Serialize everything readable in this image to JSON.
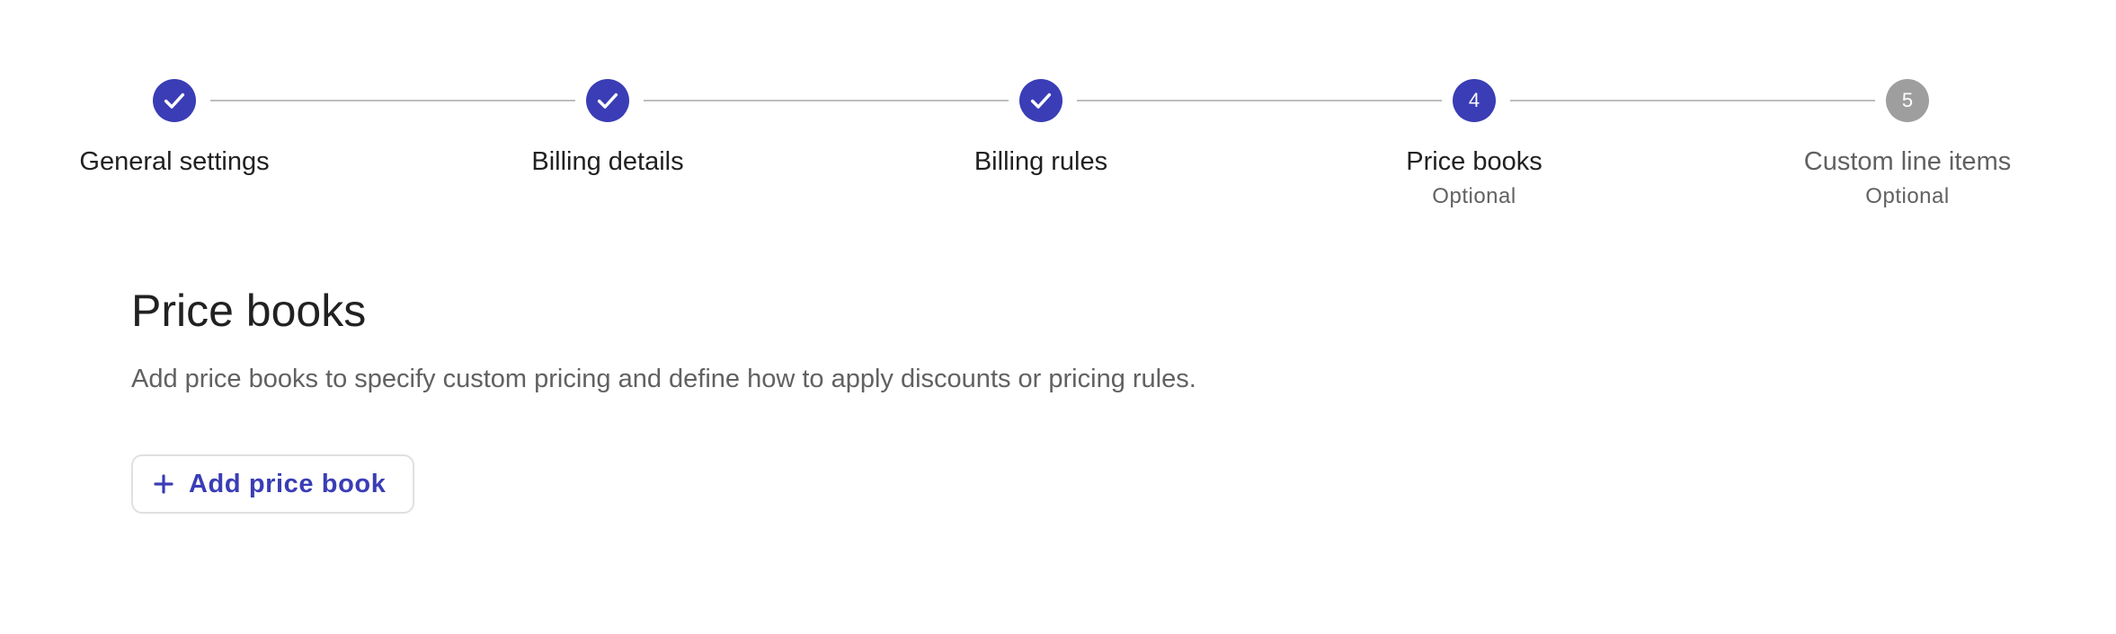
{
  "colors": {
    "accent": "#3a3db5",
    "inactive": "#9e9e9e",
    "connector": "#bdbdbd",
    "title_text": "#212121",
    "secondary_text": "#616161",
    "active_label": "#212121",
    "inactive_label": "#616161"
  },
  "stepper": {
    "steps": [
      {
        "number": "1",
        "label": "General settings",
        "sublabel": "",
        "state": "completed"
      },
      {
        "number": "2",
        "label": "Billing details",
        "sublabel": "",
        "state": "completed"
      },
      {
        "number": "3",
        "label": "Billing rules",
        "sublabel": "",
        "state": "completed"
      },
      {
        "number": "4",
        "label": "Price books",
        "sublabel": "Optional",
        "state": "active"
      },
      {
        "number": "5",
        "label": "Custom line items",
        "sublabel": "Optional",
        "state": "upcoming"
      }
    ]
  },
  "main": {
    "title": "Price books",
    "description": "Add price books to specify custom pricing and define how to apply discounts or pricing rules.",
    "add_button_label": "Add price book",
    "add_button_icon": "plus-icon"
  }
}
